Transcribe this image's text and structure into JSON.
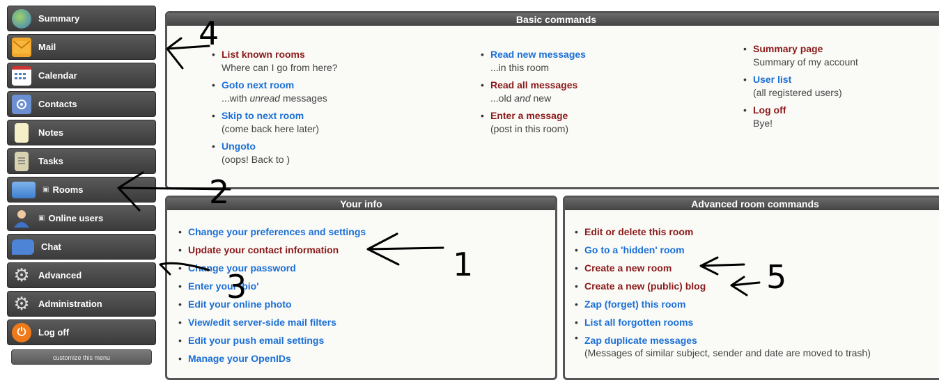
{
  "sidebar": {
    "items": [
      {
        "label": "Summary",
        "icon": "globe-icon",
        "sub": ""
      },
      {
        "label": "Mail",
        "icon": "envelope-icon",
        "sub": ""
      },
      {
        "label": "Calendar",
        "icon": "calendar-icon",
        "sub": ""
      },
      {
        "label": "Contacts",
        "icon": "contacts-icon",
        "sub": ""
      },
      {
        "label": "Notes",
        "icon": "notepad-icon",
        "sub": ""
      },
      {
        "label": "Tasks",
        "icon": "clipboard-icon",
        "sub": ""
      },
      {
        "label": "Rooms",
        "icon": "folder-icon",
        "sub": "▣"
      },
      {
        "label": "Online users",
        "icon": "user-icon",
        "sub": "▣"
      },
      {
        "label": "Chat",
        "icon": "chat-bubble-icon",
        "sub": ""
      },
      {
        "label": "Advanced",
        "icon": "gear-icon",
        "sub": ""
      },
      {
        "label": "Administration",
        "icon": "gear-icon",
        "sub": ""
      },
      {
        "label": "Log off",
        "icon": "power-icon",
        "sub": ""
      }
    ],
    "customize_label": "customize this menu"
  },
  "basic": {
    "title": "Basic commands",
    "col1": [
      {
        "link": "List known rooms",
        "note": "Where can I go from here?",
        "color": "red"
      },
      {
        "link": "Goto next room",
        "note_pre": "...with ",
        "note_em": "unread",
        "note_post": " messages",
        "color": "blue"
      },
      {
        "link": "Skip to next room",
        "note": "(come back here later)",
        "color": "blue"
      },
      {
        "link": "Ungoto",
        "note": "(oops! Back to )",
        "color": "blue"
      }
    ],
    "col2": [
      {
        "link": "Read new messages",
        "note": "...in this room",
        "color": "blue"
      },
      {
        "link": "Read all messages",
        "note_pre": "...old ",
        "note_em": "and",
        "note_post": " new",
        "color": "red"
      },
      {
        "link": "Enter a message",
        "note": "(post in this room)",
        "color": "red"
      }
    ],
    "col3": [
      {
        "link": "Summary page",
        "note": "Summary of my account",
        "color": "red"
      },
      {
        "link": "User list",
        "note": "(all registered users)",
        "color": "blue"
      },
      {
        "link": "Log off",
        "note": "Bye!",
        "color": "red"
      }
    ]
  },
  "your_info": {
    "title": "Your info",
    "items": [
      {
        "label": "Change your preferences and settings",
        "color": "blue"
      },
      {
        "label": "Update your contact information",
        "color": "red"
      },
      {
        "label": "Change your password",
        "color": "blue"
      },
      {
        "label": "Enter your 'bio'",
        "color": "blue"
      },
      {
        "label": "Edit your online photo",
        "color": "blue"
      },
      {
        "label": "View/edit server-side mail filters",
        "color": "blue"
      },
      {
        "label": "Edit your push email settings",
        "color": "blue"
      },
      {
        "label": "Manage your OpenIDs",
        "color": "blue"
      }
    ]
  },
  "advanced": {
    "title": "Advanced room commands",
    "items": [
      {
        "label": "Edit or delete this room",
        "color": "red"
      },
      {
        "label": "Go to a 'hidden' room",
        "color": "blue"
      },
      {
        "label": "Create a new room",
        "color": "red"
      },
      {
        "label": "Create a new (public) blog",
        "color": "red"
      },
      {
        "label": "Zap (forget) this room",
        "color": "blue"
      },
      {
        "label": "List all forgotten rooms",
        "color": "blue"
      },
      {
        "label": "Zap duplicate messages",
        "color": "blue"
      }
    ],
    "zap_note": "(Messages of similar subject, sender and date are moved to trash)"
  },
  "annotations": [
    "1",
    "2",
    "3",
    "4",
    "5"
  ],
  "colors": {
    "link_blue": "#1a6fd6",
    "link_red": "#8b1a1a",
    "panel_header": "#555555"
  }
}
